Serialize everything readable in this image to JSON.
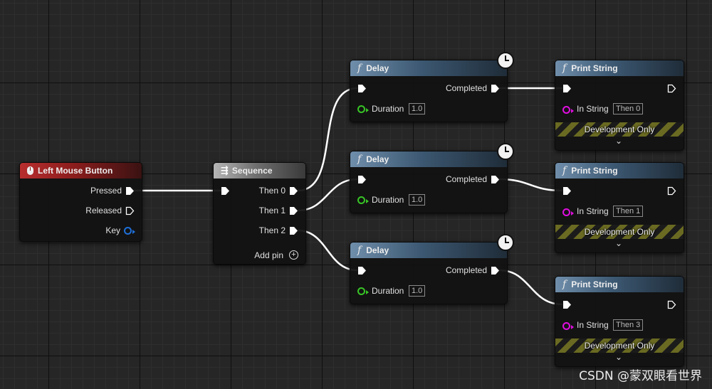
{
  "nodes": {
    "event": {
      "title": "Left Mouse Button",
      "icon": "mouse-icon",
      "pins": {
        "pressed": "Pressed",
        "released": "Released",
        "key": "Key"
      }
    },
    "sequence": {
      "title": "Sequence",
      "icon": "sequence-icon",
      "pins": {
        "then0": "Then 0",
        "then1": "Then 1",
        "then2": "Then 2"
      },
      "add_pin": "Add pin"
    },
    "delays": [
      {
        "title": "Delay",
        "completed": "Completed",
        "duration_label": "Duration",
        "duration_value": "1.0"
      },
      {
        "title": "Delay",
        "completed": "Completed",
        "duration_label": "Duration",
        "duration_value": "1.0"
      },
      {
        "title": "Delay",
        "completed": "Completed",
        "duration_label": "Duration",
        "duration_value": "1.0"
      }
    ],
    "prints": [
      {
        "title": "Print String",
        "in_string_label": "In String",
        "in_string_value": "Then 0",
        "dev_label": "Development Only"
      },
      {
        "title": "Print String",
        "in_string_label": "In String",
        "in_string_value": "Then 1",
        "dev_label": "Development Only"
      },
      {
        "title": "Print String",
        "in_string_label": "In String",
        "in_string_value": "Then 3",
        "dev_label": "Development Only"
      }
    ]
  },
  "watermark": "CSDN @蒙双眼看世界",
  "colors": {
    "function_header": "#3c5872",
    "event_header": "#8a1c1c",
    "sequence_header": "#707070",
    "exec_wire": "#ffffff",
    "key_pin": "#1e6fd9",
    "float_pin": "#38c626",
    "string_pin": "#e00ee0"
  }
}
